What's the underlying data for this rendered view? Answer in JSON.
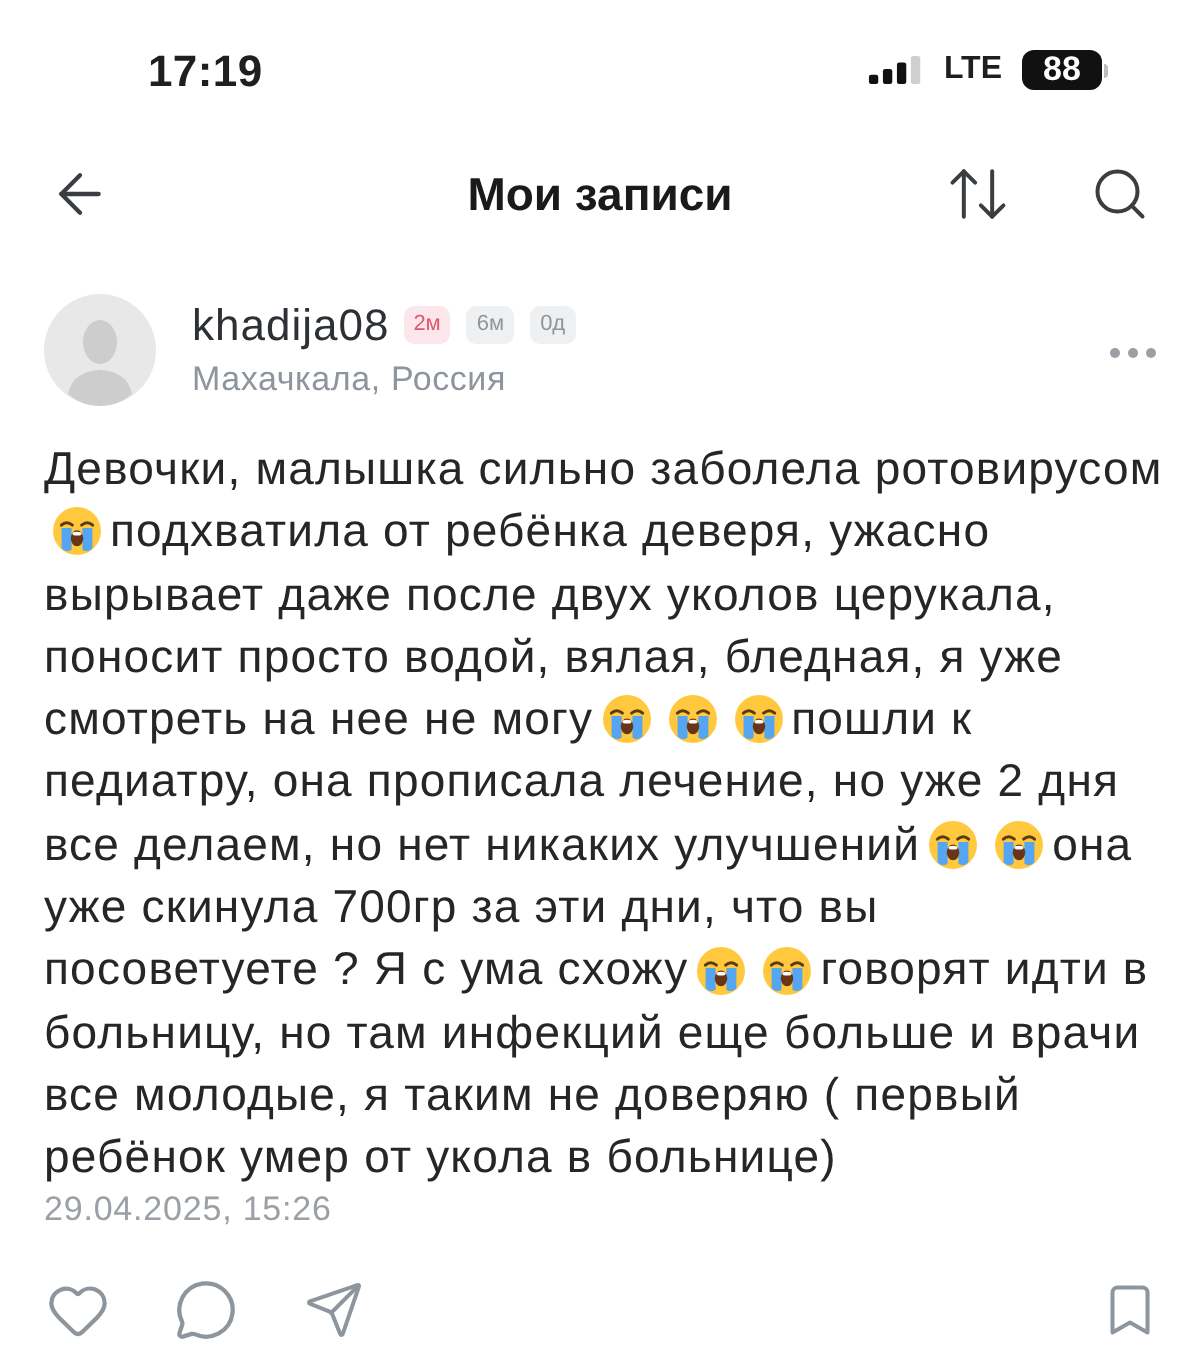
{
  "status_bar": {
    "time": "17:19",
    "network": "LTE",
    "battery": "88"
  },
  "nav": {
    "title": "Мои записи"
  },
  "post": {
    "author": {
      "name": "khadija08",
      "location": "Махачкала, Россия",
      "badges": [
        {
          "text": "2м",
          "color": "#e0566f"
        },
        {
          "text": "6м",
          "color": "#8e959c"
        },
        {
          "text": "0д",
          "color": "#8e959c"
        }
      ]
    },
    "body_lines": [
      [
        {
          "kind": "text",
          "text": "Девочки, малышка сильно заболела ротовирусом"
        }
      ],
      [
        {
          "kind": "emoji"
        },
        {
          "kind": "text",
          "text": "подхватила от ребёнка деверя, ужасно"
        }
      ],
      [
        {
          "kind": "text",
          "text": "вырывает даже после двух уколов церукала,"
        }
      ],
      [
        {
          "kind": "text",
          "text": "поносит просто водой, вялая, бледная, я уже"
        }
      ],
      [
        {
          "kind": "text",
          "text": "смотреть на нее не могу"
        },
        {
          "kind": "emoji"
        },
        {
          "kind": "emoji"
        },
        {
          "kind": "emoji"
        },
        {
          "kind": "text",
          "text": "пошли к"
        }
      ],
      [
        {
          "kind": "text",
          "text": "педиатру, она прописала лечение, но уже 2 дня"
        }
      ],
      [
        {
          "kind": "text",
          "text": "все делаем, но нет никаких улучшений"
        },
        {
          "kind": "emoji"
        },
        {
          "kind": "emoji"
        },
        {
          "kind": "text",
          "text": "она"
        }
      ],
      [
        {
          "kind": "text",
          "text": "уже скинула 700гр за эти дни, что вы"
        }
      ],
      [
        {
          "kind": "text",
          "text": "посоветуете ? Я с ума схожу"
        },
        {
          "kind": "emoji"
        },
        {
          "kind": "emoji"
        },
        {
          "kind": "text",
          "text": "говорят идти в"
        }
      ],
      [
        {
          "kind": "text",
          "text": "больницу, но там инфекций еще больше и врачи"
        }
      ],
      [
        {
          "kind": "text",
          "text": "все молодые, я таким не доверяю ( первый"
        }
      ],
      [
        {
          "kind": "text",
          "text": "ребёнок умер от укола в больнице)"
        }
      ]
    ],
    "date": "29.04.2025, 15:26"
  }
}
